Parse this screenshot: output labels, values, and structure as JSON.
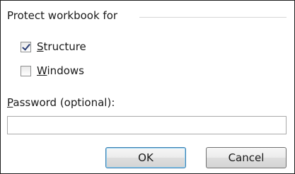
{
  "group": {
    "title": "Protect workbook for"
  },
  "options": [
    {
      "label_accel": "S",
      "label_rest": "tructure",
      "checked": true
    },
    {
      "label_accel": "W",
      "label_rest": "indows",
      "checked": false
    }
  ],
  "password": {
    "label_accel": "P",
    "label_rest": "assword (optional):",
    "value": ""
  },
  "buttons": {
    "ok": "OK",
    "cancel": "Cancel"
  }
}
